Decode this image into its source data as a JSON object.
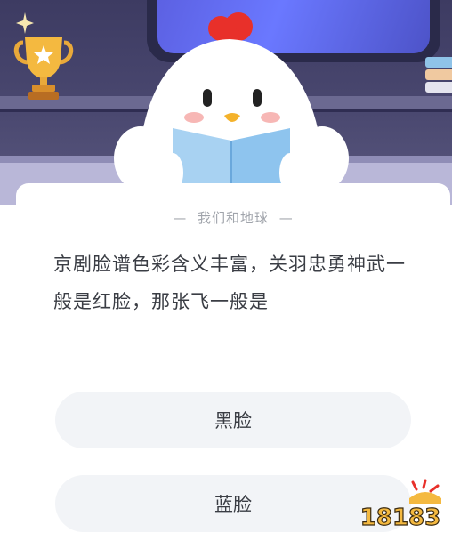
{
  "quiz": {
    "category_label": "我们和地球",
    "category_dash_left": "—",
    "category_dash_right": "—",
    "question": "京剧脸谱色彩含义丰富，关羽忠勇神武一般是红脸，那张飞一般是",
    "options": [
      {
        "label": "黑脸"
      },
      {
        "label": "蓝脸"
      }
    ]
  },
  "watermark": {
    "text": "18183"
  },
  "colors": {
    "accent_red": "#e8302a",
    "text_main": "#3a3d44",
    "text_muted": "#a0a4ab",
    "option_bg": "#f2f4f7"
  }
}
